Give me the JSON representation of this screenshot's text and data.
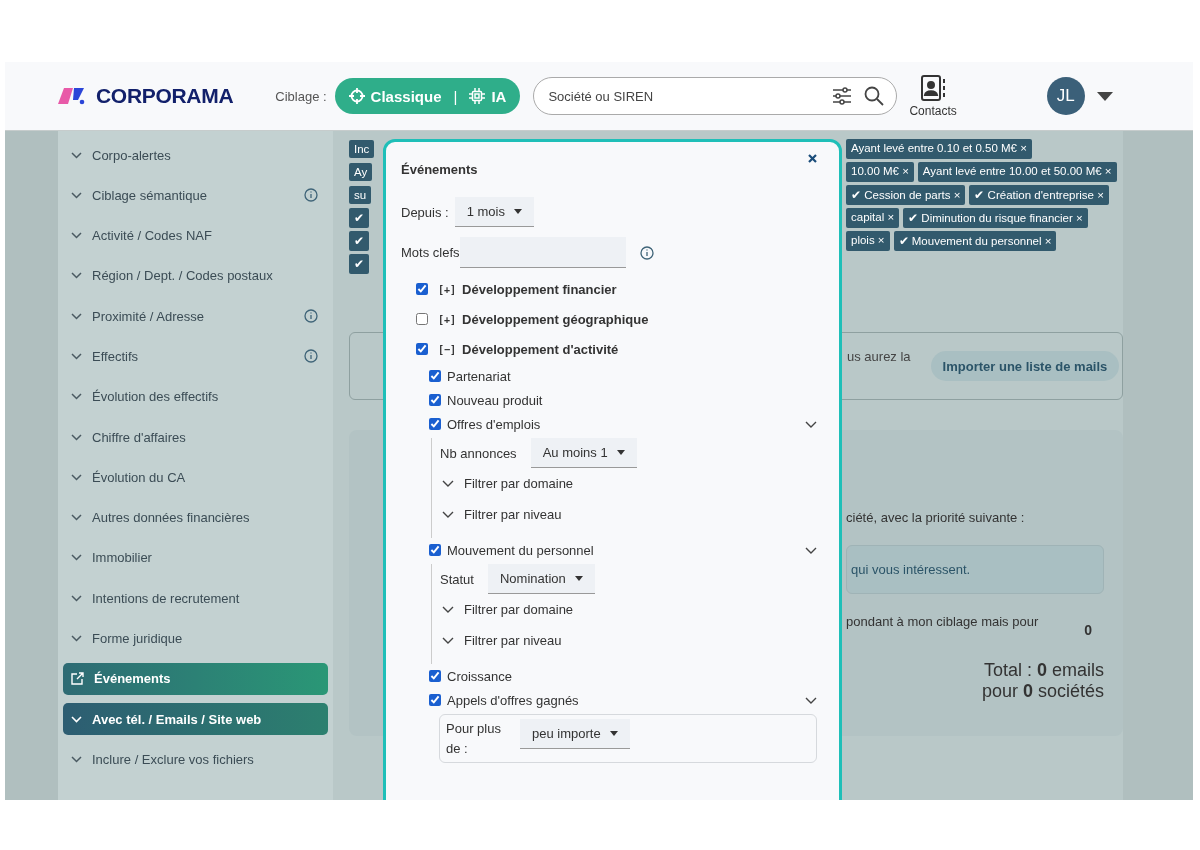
{
  "header": {
    "logo": "CORPORAMA",
    "targeting_label": "Ciblage :",
    "modes": [
      "Classique",
      "IA"
    ],
    "mode_separator": "|",
    "search": {
      "placeholder": "Société ou SIREN"
    },
    "contacts_label": "Contacts",
    "avatar": "JL"
  },
  "sidebar": {
    "items": [
      {
        "label": "Corpo-alertes",
        "info": false,
        "kind": "collapsible"
      },
      {
        "label": "Ciblage sémantique",
        "info": true,
        "kind": "collapsible"
      },
      {
        "label": "Activité / Codes NAF",
        "info": false,
        "kind": "collapsible"
      },
      {
        "label": "Région / Dept. / Codes postaux",
        "info": false,
        "kind": "collapsible"
      },
      {
        "label": "Proximité / Adresse",
        "info": true,
        "kind": "collapsible"
      },
      {
        "label": "Effectifs",
        "info": true,
        "kind": "collapsible"
      },
      {
        "label": "Évolution des effectifs",
        "info": false,
        "kind": "collapsible"
      },
      {
        "label": "Chiffre d'affaires",
        "info": false,
        "kind": "collapsible"
      },
      {
        "label": "Évolution du CA",
        "info": false,
        "kind": "collapsible"
      },
      {
        "label": "Autres données financières",
        "info": false,
        "kind": "collapsible"
      },
      {
        "label": "Immobilier",
        "info": false,
        "kind": "collapsible"
      },
      {
        "label": "Intentions de recrutement",
        "info": false,
        "kind": "collapsible"
      },
      {
        "label": "Forme juridique",
        "info": false,
        "kind": "collapsible"
      },
      {
        "label": "Événements",
        "info": false,
        "kind": "external"
      },
      {
        "label": "Avec tél. / Emails / Site web",
        "info": false,
        "kind": "primary"
      },
      {
        "label": "Inclure / Exclure vos fichiers",
        "info": false,
        "kind": "collapsible"
      }
    ]
  },
  "tag_rows": [
    {
      "left": "Inc",
      "right": [
        "Ayant levé entre 0.10 et 0.50 M€ ×"
      ]
    },
    {
      "left": "Ay",
      "right": [
        "10.00 M€ ×",
        "Ayant levé entre 10.00 et 50.00 M€ ×"
      ]
    },
    {
      "left": "su",
      "right": [
        "✔ Cession de parts ×",
        "✔ Création d'entreprise ×"
      ]
    },
    {
      "left": "✔",
      "right": [
        "capital ×",
        "✔ Diminution du risque financier ×"
      ]
    },
    {
      "left": "✔",
      "right": [
        "plois ×",
        "✔ Mouvement du personnel ×"
      ]
    },
    {
      "left": "✔",
      "right": []
    }
  ],
  "import_card": {
    "text": "us aurez la",
    "button": "Importer une liste de mails"
  },
  "summary_card": {
    "priority_text": "ciété, avec la priorité suivante :",
    "info": "qui vous intéressent.",
    "option_text": "pondant à mon ciblage mais pour",
    "option_count": "0",
    "total": "Total : **0** emails",
    "total_companies": "pour **0** sociétés"
  },
  "modal": {
    "title": "Événements",
    "since": {
      "label": "Depuis :",
      "value": "1 mois"
    },
    "keywords": {
      "label": "Mots clefs"
    },
    "categories": [
      {
        "toggle": "[+]",
        "label": "Développement financier",
        "checked": true
      },
      {
        "toggle": "[+]",
        "label": "Développement géographique",
        "checked": false
      },
      {
        "toggle": "[−]",
        "label": "Développement d'activité",
        "checked": true,
        "children": [
          {
            "label": "Partenariat",
            "checked": true
          },
          {
            "label": "Nouveau produit",
            "checked": true
          },
          {
            "label": "Offres d'emplois",
            "checked": true,
            "expanded": true,
            "filter": {
              "label": "Nb annonces",
              "value": "Au moins 1",
              "subfilters": [
                "Filtrer par domaine",
                "Filtrer par niveau"
              ]
            }
          },
          {
            "label": "Mouvement du personnel",
            "checked": true,
            "expanded": true,
            "filter": {
              "label": "Statut",
              "value": "Nomination",
              "subfilters": [
                "Filtrer par domaine",
                "Filtrer par niveau"
              ]
            }
          },
          {
            "label": "Croissance",
            "checked": true
          },
          {
            "label": "Appels d'offres gagnés",
            "checked": true,
            "expanded": true,
            "amount": {
              "label": "Pour plus de :",
              "value": "peu importe"
            }
          }
        ]
      }
    ]
  }
}
